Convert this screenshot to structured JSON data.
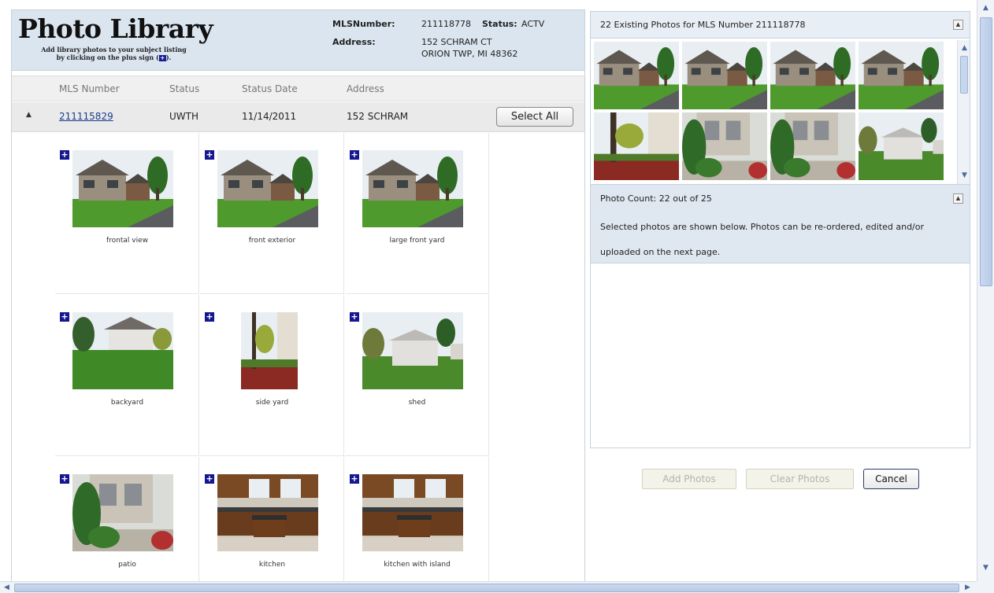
{
  "header": {
    "title": "Photo Library",
    "subtitle_line1": "Add library photos to your subject listing",
    "subtitle_line2": "by clicking on the plus sign (",
    "subtitle_tail": ").",
    "mls_label": "MLSNumber:",
    "mls_value": "211118778",
    "status_label": "Status:",
    "status_value": "ACTV",
    "address_label": "Address:",
    "address_line1": "152 SCHRAM CT",
    "address_line2": "ORION TWP, MI 48362"
  },
  "table": {
    "columns": [
      "MLS Number",
      "Status",
      "Status Date",
      "Address"
    ],
    "row": {
      "expander": "▲",
      "mls_number": "211115829",
      "status": "UWTH",
      "status_date": "11/14/2011",
      "address": "152 SCHRAM",
      "select_all": "Select All"
    },
    "plus_label": "+",
    "photos": [
      {
        "caption": "frontal view",
        "scene": "house"
      },
      {
        "caption": "front exterior",
        "scene": "house"
      },
      {
        "caption": "large front yard",
        "scene": "house"
      },
      {
        "caption": "backyard",
        "scene": "yard"
      },
      {
        "caption": "side yard",
        "scene": "side"
      },
      {
        "caption": "shed",
        "scene": "shed"
      },
      {
        "caption": "patio",
        "scene": "patio"
      },
      {
        "caption": "kitchen",
        "scene": "kitchen"
      },
      {
        "caption": "kitchen with island",
        "scene": "kitchen"
      }
    ]
  },
  "existing_panel": {
    "title": "22 Existing Photos for MLS Number 211118778",
    "collapse_icon": "▲",
    "thumbnails": [
      "house",
      "house",
      "house",
      "house",
      "side",
      "patio",
      "patio",
      "shed"
    ]
  },
  "count_panel": {
    "title": "Photo Count: 22 out of 25",
    "message": "Selected photos are shown below. Photos can be re-ordered, edited and/or uploaded on the next page.",
    "collapse_icon": "▲"
  },
  "buttons": {
    "add": "Add Photos",
    "clear": "Clear Photos",
    "cancel": "Cancel"
  },
  "scroll": {
    "up": "▲",
    "down": "▼",
    "left": "◀",
    "right": "▶"
  },
  "colors": {
    "header_bg": "#dbe5ef",
    "plus_icon": "#15178f",
    "link": "#1a3c8a",
    "grass": "#4f8a2a",
    "sky": "#e9eef3"
  }
}
